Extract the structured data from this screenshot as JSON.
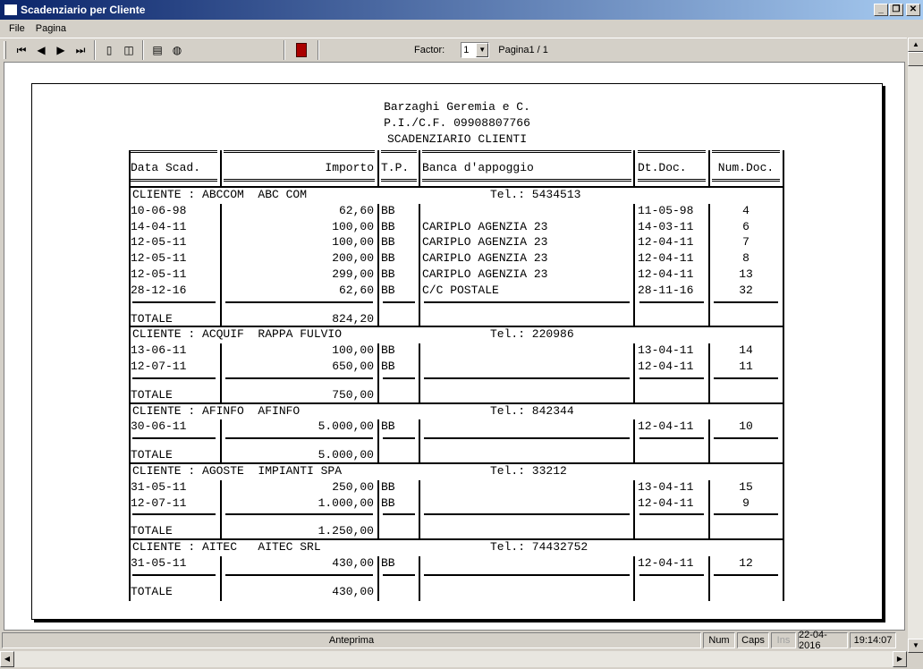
{
  "window": {
    "title": "Scadenziario per Cliente",
    "minimize": "_",
    "restore": "❐",
    "close": "✕"
  },
  "menu": [
    "File",
    "Pagina"
  ],
  "toolbar": {
    "factor_label": "Factor:",
    "factor_value": "1",
    "page_label": "Pagina1 / 1"
  },
  "status": {
    "main": "Anteprima",
    "num": "Num",
    "caps": "Caps",
    "ins": "Ins",
    "date": "22-04-2016",
    "time": "19:14:07"
  },
  "report": {
    "company": "Barzaghi Geremia e C.",
    "vat": "P.I./C.F. 09908807766",
    "title": "SCADENZIARIO CLIENTI",
    "columns": [
      "Data Scad.",
      "Importo",
      "T.P.",
      "Banca d'appoggio",
      "Dt.Doc.",
      "Num.Doc."
    ],
    "clients": [
      {
        "header": "CLIENTE : ABCCOM  ABC COM",
        "tel": "Tel.: 5434513",
        "rows": [
          [
            "10-06-98",
            "62,60",
            "BB",
            "",
            "11-05-98",
            "4"
          ],
          [
            "14-04-11",
            "100,00",
            "BB",
            "CARIPLO AGENZIA 23",
            "14-03-11",
            "6"
          ],
          [
            "12-05-11",
            "100,00",
            "BB",
            "CARIPLO AGENZIA 23",
            "12-04-11",
            "7"
          ],
          [
            "12-05-11",
            "200,00",
            "BB",
            "CARIPLO AGENZIA 23",
            "12-04-11",
            "8"
          ],
          [
            "12-05-11",
            "299,00",
            "BB",
            "CARIPLO AGENZIA 23",
            "12-04-11",
            "13"
          ],
          [
            "28-12-16",
            "62,60",
            "BB",
            "C/C POSTALE",
            "28-11-16",
            "32"
          ]
        ],
        "total_label": "TOTALE",
        "total": "824,20"
      },
      {
        "header": "CLIENTE : ACQUIF  RAPPA FULVIO",
        "tel": "Tel.: 220986",
        "rows": [
          [
            "13-06-11",
            "100,00",
            "BB",
            "",
            "13-04-11",
            "14"
          ],
          [
            "12-07-11",
            "650,00",
            "BB",
            "",
            "12-04-11",
            "11"
          ]
        ],
        "total_label": "TOTALE",
        "total": "750,00"
      },
      {
        "header": "CLIENTE : AFINFO  AFINFO",
        "tel": "Tel.: 842344",
        "rows": [
          [
            "30-06-11",
            "5.000,00",
            "BB",
            "",
            "12-04-11",
            "10"
          ]
        ],
        "total_label": "TOTALE",
        "total": "5.000,00"
      },
      {
        "header": "CLIENTE : AGOSTE  IMPIANTI SPA",
        "tel": "Tel.: 33212",
        "rows": [
          [
            "31-05-11",
            "250,00",
            "BB",
            "",
            "13-04-11",
            "15"
          ],
          [
            "12-07-11",
            "1.000,00",
            "BB",
            "",
            "12-04-11",
            "9"
          ]
        ],
        "total_label": "TOTALE",
        "total": "1.250,00"
      },
      {
        "header": "CLIENTE : AITEC   AITEC SRL",
        "tel": "Tel.: 74432752",
        "rows": [
          [
            "31-05-11",
            "430,00",
            "BB",
            "",
            "12-04-11",
            "12"
          ]
        ],
        "total_label": "TOTALE",
        "total": "430,00"
      }
    ]
  }
}
